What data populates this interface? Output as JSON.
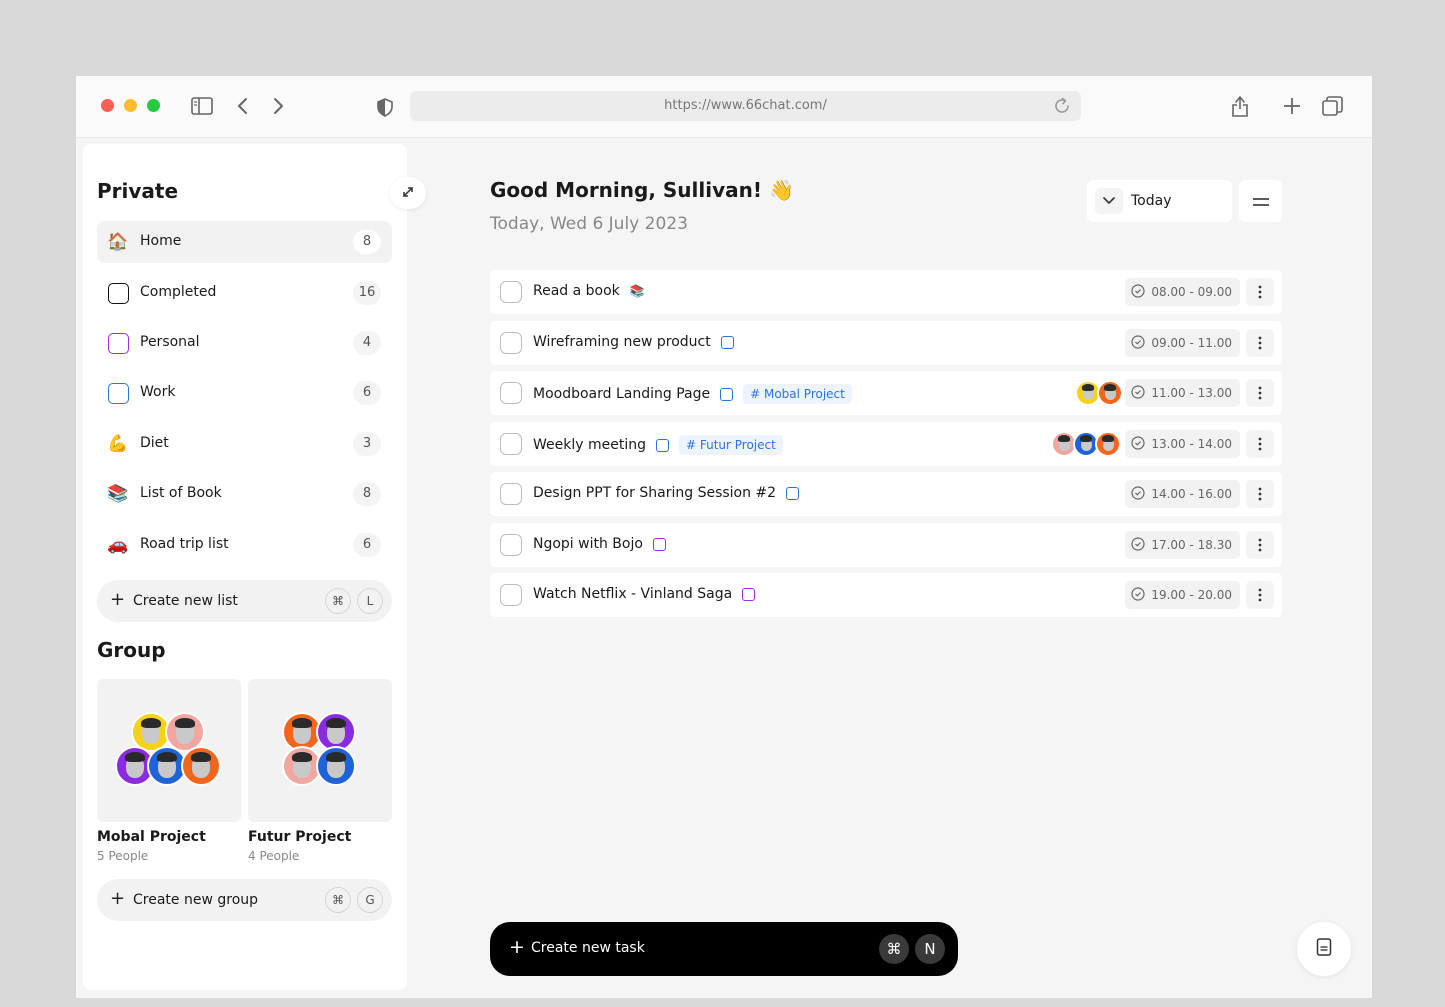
{
  "browser": {
    "url": "https://www.66chat.com/",
    "icons": [
      "sidebar-toggle-icon",
      "back-icon",
      "forward-icon",
      "shield-icon",
      "reload-icon",
      "share-icon",
      "new-tab-icon",
      "tabs-icon"
    ]
  },
  "sidebar": {
    "private_title": "Private",
    "lists": [
      {
        "label": "Home",
        "count": "8",
        "icon": "house-emoji",
        "glyph": "🏠",
        "active": true
      },
      {
        "label": "Completed",
        "count": "16",
        "icon": "square-black-icon",
        "color": "#111111"
      },
      {
        "label": "Personal",
        "count": "4",
        "icon": "square-purple-icon",
        "color": "#9b30e6"
      },
      {
        "label": "Work",
        "count": "6",
        "icon": "square-blue-icon",
        "color": "#2b74e0"
      },
      {
        "label": "Diet",
        "count": "3",
        "icon": "flexed-biceps-emoji",
        "glyph": "💪"
      },
      {
        "label": "List of Book",
        "count": "8",
        "icon": "books-emoji",
        "glyph": "📚"
      },
      {
        "label": "Road trip list",
        "count": "6",
        "icon": "car-emoji",
        "glyph": "🚗"
      }
    ],
    "create_list": {
      "label": "Create new list",
      "key1": "⌘",
      "key2": "L"
    },
    "group_title": "Group",
    "groups": [
      {
        "name": "Mobal Project",
        "people": "5 People"
      },
      {
        "name": "Futur Project",
        "people": "4 People"
      }
    ],
    "create_group": {
      "label": "Create new group",
      "key1": "⌘",
      "key2": "G"
    }
  },
  "main": {
    "greeting": "Good Morning, Sullivan! 👋",
    "date": "Today, Wed 6 July 2023",
    "filter_label": "Today",
    "tasks": [
      {
        "title": "Read a book",
        "time": "08.00 - 09.00",
        "list_icon": "books-emoji",
        "list_glyph": "📚"
      },
      {
        "title": "Wireframing new product",
        "time": "09.00 - 11.00",
        "list_icon": "square-blue-icon",
        "list_color": "#2b74e0"
      },
      {
        "title": "Moodboard Landing Page",
        "time": "11.00 - 13.00",
        "list_icon": "square-blue-icon",
        "list_color": "#2b74e0",
        "tag": "# Mobal Project"
      },
      {
        "title": "Weekly meeting",
        "time": "13.00 - 14.00",
        "list_icon": "square-blue-icon",
        "list_color": "#2b74e0",
        "tag": "# Futur Project"
      },
      {
        "title": "Design PPT for Sharing Session #2",
        "time": "14.00 - 16.00",
        "list_icon": "square-blue-icon",
        "list_color": "#2b74e0"
      },
      {
        "title": "Ngopi with Bojo",
        "time": "17.00 - 18.30",
        "list_icon": "square-purple-icon",
        "list_color": "#9b30e6"
      },
      {
        "title": "Watch Netflix - Vinland Saga",
        "time": "19.00 - 20.00",
        "list_icon": "square-purple-icon",
        "list_color": "#9b30e6"
      }
    ],
    "create_task": {
      "label": "Create new task",
      "key1": "⌘",
      "key2": "N"
    }
  },
  "colors": {
    "accent_blue": "#2b74e0",
    "accent_purple": "#9b30e6",
    "avatar_yellow": "#f5d21a",
    "avatar_orange": "#f2661c",
    "avatar_pink": "#f1a7a0",
    "avatar_purple": "#8a2be2",
    "avatar_blue": "#1f63d8"
  }
}
